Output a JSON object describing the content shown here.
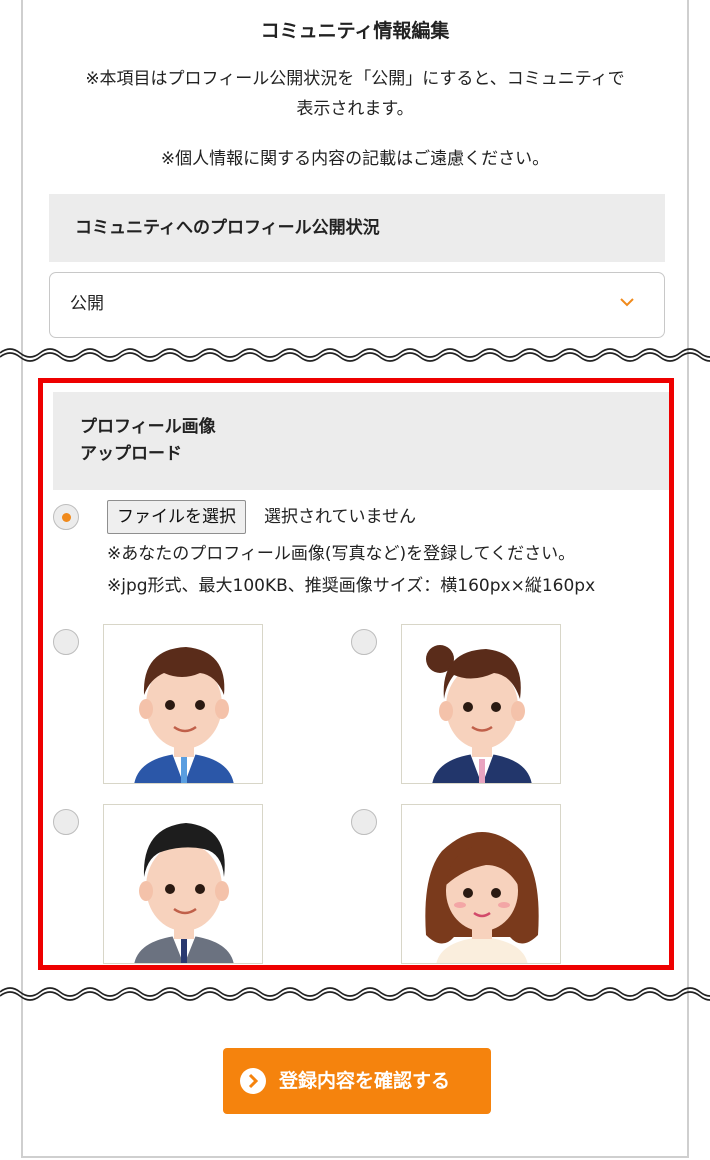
{
  "page": {
    "title": "コミュニティ情報編集",
    "note_line1": "※本項目はプロフィール公開状況を「公開」にすると、コミュニティで",
    "note_line2": "表示されます。",
    "note_line3": "※個人情報に関する内容の記載はご遠慮ください。"
  },
  "visibility": {
    "section_label": "コミュニティへのプロフィール公開状況",
    "selected_value": "公開",
    "chevron_icon": "chevron-down-icon",
    "accent_color": "#f08a1c"
  },
  "profile_image": {
    "section_label_line1": "プロフィール画像",
    "section_label_line2": "アップロード",
    "file_button_label": "ファイルを選択",
    "file_status": "選択されていません",
    "hint_line1": "※あなたのプロフィール画像(写真など)を登録してください。",
    "hint_line2": "※jpg形式、最大100KB、推奨画像サイズ：横160px×縦160px",
    "selected_option": "upload",
    "avatars": [
      {
        "name": "avatar-man-blue-suit",
        "selected": false
      },
      {
        "name": "avatar-woman-navy-suit",
        "selected": false
      },
      {
        "name": "avatar-man-gray-suit",
        "selected": false
      },
      {
        "name": "avatar-woman-casual",
        "selected": false
      }
    ],
    "highlight_color": "#ee0000"
  },
  "submit": {
    "label": "登録内容を確認する",
    "icon": "chevron-right-circle-icon",
    "color": "#f5830d"
  }
}
